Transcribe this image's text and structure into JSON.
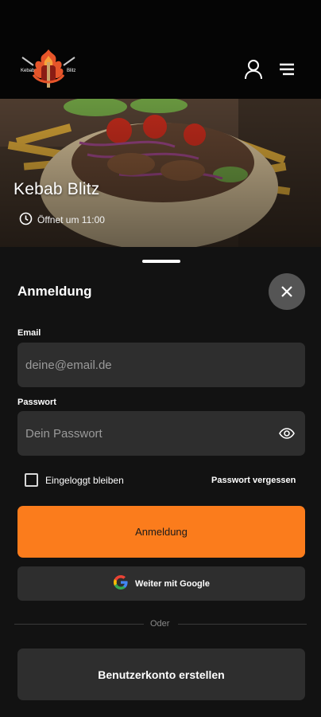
{
  "header": {
    "logo_text_left": "Kebab",
    "logo_text_right": "Blitz",
    "profile_icon": "user-icon",
    "menu_icon": "hamburger-menu-icon"
  },
  "hero": {
    "restaurant_name": "Kebab Blitz",
    "opening_text": "Öffnet um 11:00",
    "clock_icon": "clock-icon"
  },
  "login": {
    "title": "Anmeldung",
    "close_icon": "close-icon",
    "email_label": "Email",
    "email_placeholder": "deine@email.de",
    "password_label": "Passwort",
    "password_placeholder": "Dein Passwort",
    "remember_label": "Eingeloggt bleiben",
    "forgot_label": "Passwort vergessen",
    "submit_label": "Anmeldung",
    "google_label": "Weiter mit Google",
    "or_label": "Oder",
    "create_account_label": "Benutzerkonto erstellen"
  },
  "colors": {
    "accent": "#fb7c1c",
    "background": "#121212",
    "field": "#2e2e2e"
  }
}
